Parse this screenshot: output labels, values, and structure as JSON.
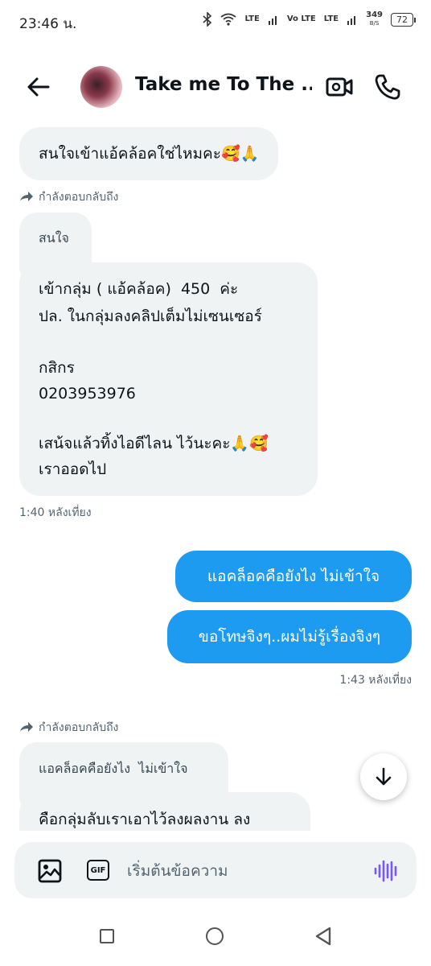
{
  "status_bar": {
    "time": "23:46 น.",
    "network_speed_value": "349",
    "network_speed_unit": "B/S",
    "battery": "72",
    "signal_labels": [
      "LTE",
      "Vo LTE",
      "LTE"
    ]
  },
  "header": {
    "title": "Take me To The ...",
    "back_icon": "arrow-left-icon",
    "video_icon": "video-camera-icon",
    "phone_icon": "phone-icon"
  },
  "messages": [
    {
      "id": "m1",
      "direction": "in",
      "text": "สนใจเข้าแอ้คล้อคใช่ไหมคะ🥰🙏"
    },
    {
      "id": "m2_reply_label",
      "text": "กำลังตอบกลับถึง"
    },
    {
      "id": "m2_quote",
      "text": "สนใจ"
    },
    {
      "id": "m2",
      "direction": "in",
      "lines": [
        "เข้ากลุ่ม ( แอ้คล้อค)  450  ค่ะ",
        "ปล. ในกลุ่มลงคลิปเต็มไม่เซนเซอร์",
        "",
        "กสิกร",
        "0203953976",
        "",
        "เสน้จแล้วทิ้งไอดีไลน ไว้นะคะ🙏🥰",
        "เราออดไป"
      ]
    },
    {
      "id": "m2_time",
      "text": "1:40 หลังเที่ยง"
    },
    {
      "id": "m3",
      "direction": "out",
      "text": "แอคล็อคคือยังไง  ไม่เข้าใจ"
    },
    {
      "id": "m4",
      "direction": "out",
      "text": "ขอโทษจิงๆ..ผมไม่รู้เรื่องจิงๆ"
    },
    {
      "id": "m4_time",
      "text": "1:43 หลังเที่ยง"
    },
    {
      "id": "m5_reply_label",
      "text": "กำลังตอบกลับถึง"
    },
    {
      "id": "m5_quote",
      "text": "แอคล็อคคือยังไง  ไม่เข้าใจ"
    },
    {
      "id": "m5",
      "direction": "in",
      "text": "คือกลุ่มลับเราเอาไว้ลงผลงาน ลง"
    }
  ],
  "composer": {
    "placeholder": "เริ่มต้นข้อความ",
    "gif_label": "GIF"
  },
  "colors": {
    "outgoing_bubble": "#1d9bf0",
    "incoming_bubble": "#eff3f4",
    "voice_accent": "#7856ff"
  }
}
